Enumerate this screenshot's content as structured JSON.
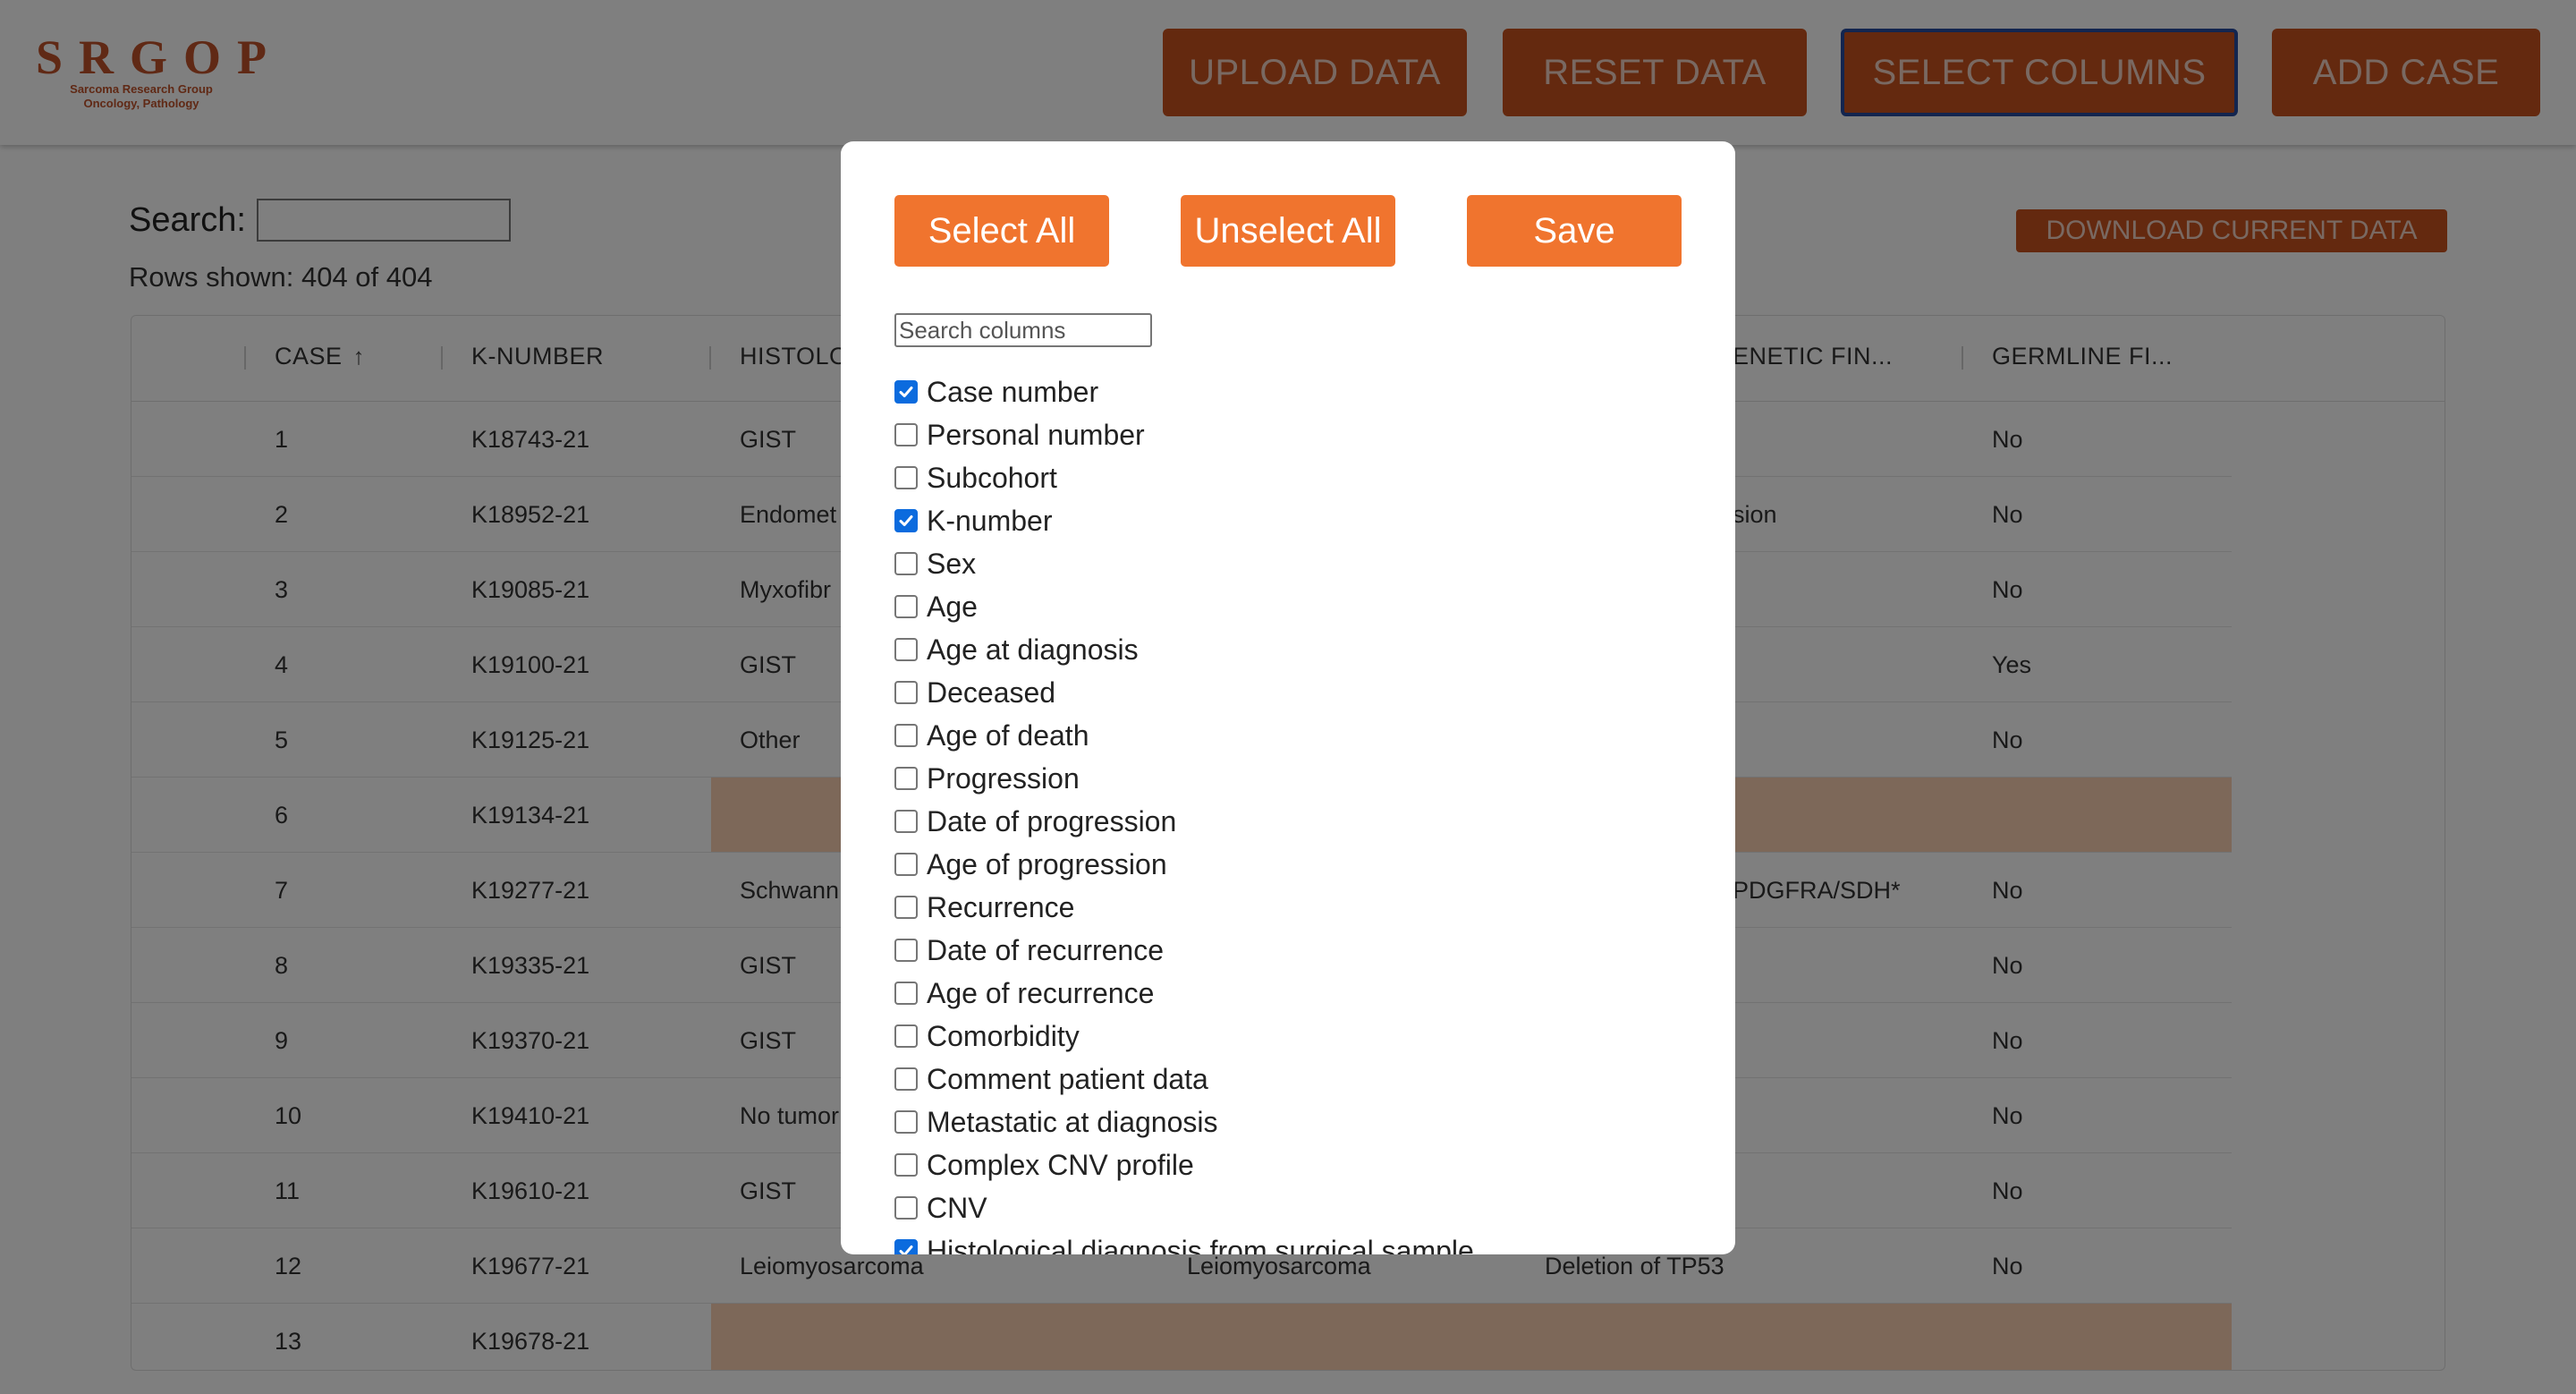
{
  "brand": {
    "logo_text": "SRGOP",
    "logo_subtitle_line1": "Sarcoma Research Group",
    "logo_subtitle_line2": "Oncology, Pathology"
  },
  "toolbar": {
    "upload_label": "UPLOAD DATA",
    "reset_label": "RESET DATA",
    "select_columns_label": "SELECT COLUMNS",
    "add_case_label": "ADD CASE"
  },
  "search": {
    "label": "Search:",
    "value": "",
    "rows_shown": "Rows shown: 404 of 404"
  },
  "download_label": "DOWNLOAD CURRENT DATA",
  "table": {
    "headers": [
      "CASE",
      "K-NUMBER",
      "HISTOLO",
      "ENETIC FIN...",
      "GERMLINE FI..."
    ],
    "rows": [
      {
        "case": "1",
        "k": "K18743-21",
        "histo": "GIST",
        "histo2": "",
        "genetic": "",
        "germline": "No"
      },
      {
        "case": "2",
        "k": "K18952-21",
        "histo": "Endomet",
        "histo2": "",
        "genetic": "sion",
        "germline": "No"
      },
      {
        "case": "3",
        "k": "K19085-21",
        "histo": "Myxofibr",
        "histo2": "",
        "genetic": "",
        "germline": "No"
      },
      {
        "case": "4",
        "k": "K19100-21",
        "histo": "GIST",
        "histo2": "",
        "genetic": "",
        "germline": "Yes"
      },
      {
        "case": "5",
        "k": "K19125-21",
        "histo": "Other",
        "histo2": "",
        "genetic": "",
        "germline": "No"
      },
      {
        "case": "6",
        "k": "K19134-21",
        "histo": "",
        "histo2": "",
        "genetic": "",
        "germline": ""
      },
      {
        "case": "7",
        "k": "K19277-21",
        "histo": "Schwann",
        "histo2": "",
        "genetic": "PDGFRA/SDH*",
        "germline": "No"
      },
      {
        "case": "8",
        "k": "K19335-21",
        "histo": "GIST",
        "histo2": "",
        "genetic": "",
        "germline": "No"
      },
      {
        "case": "9",
        "k": "K19370-21",
        "histo": "GIST",
        "histo2": "",
        "genetic": "",
        "germline": "No"
      },
      {
        "case": "10",
        "k": "K19410-21",
        "histo": "No tumor",
        "histo2": "",
        "genetic": "",
        "germline": "No"
      },
      {
        "case": "11",
        "k": "K19610-21",
        "histo": "GIST",
        "histo2": "",
        "genetic": "",
        "germline": "No"
      },
      {
        "case": "12",
        "k": "K19677-21",
        "histo": "Leiomyosarcoma",
        "histo2": "Leiomyosarcoma",
        "genetic": "Deletion of TP53",
        "germline": "No"
      },
      {
        "case": "13",
        "k": "K19678-21",
        "histo": "",
        "histo2": "",
        "genetic": "",
        "germline": ""
      }
    ]
  },
  "modal": {
    "select_all_label": "Select All",
    "unselect_all_label": "Unselect All",
    "save_label": "Save",
    "search_placeholder": "Search columns",
    "columns": [
      {
        "label": "Case number",
        "checked": true
      },
      {
        "label": "Personal number",
        "checked": false
      },
      {
        "label": "Subcohort",
        "checked": false
      },
      {
        "label": "K-number",
        "checked": true
      },
      {
        "label": "Sex",
        "checked": false
      },
      {
        "label": "Age",
        "checked": false
      },
      {
        "label": "Age at diagnosis",
        "checked": false
      },
      {
        "label": "Deceased",
        "checked": false
      },
      {
        "label": "Age of death",
        "checked": false
      },
      {
        "label": "Progression",
        "checked": false
      },
      {
        "label": "Date of progression",
        "checked": false
      },
      {
        "label": "Age of progression",
        "checked": false
      },
      {
        "label": "Recurrence",
        "checked": false
      },
      {
        "label": "Date of recurrence",
        "checked": false
      },
      {
        "label": "Age of recurrence",
        "checked": false
      },
      {
        "label": "Comorbidity",
        "checked": false
      },
      {
        "label": "Comment patient data",
        "checked": false
      },
      {
        "label": "Metastatic at diagnosis",
        "checked": false
      },
      {
        "label": "Complex CNV profile",
        "checked": false
      },
      {
        "label": "CNV",
        "checked": false
      },
      {
        "label": "Histological diagnosis from surgical sample",
        "checked": true
      }
    ]
  },
  "colors": {
    "accent": "#f0742e",
    "toolbar_button": "#c9531f",
    "highlight_row": "#fbd1b3",
    "checkbox_checked": "#0b6bde",
    "active_border": "#274b9e"
  }
}
